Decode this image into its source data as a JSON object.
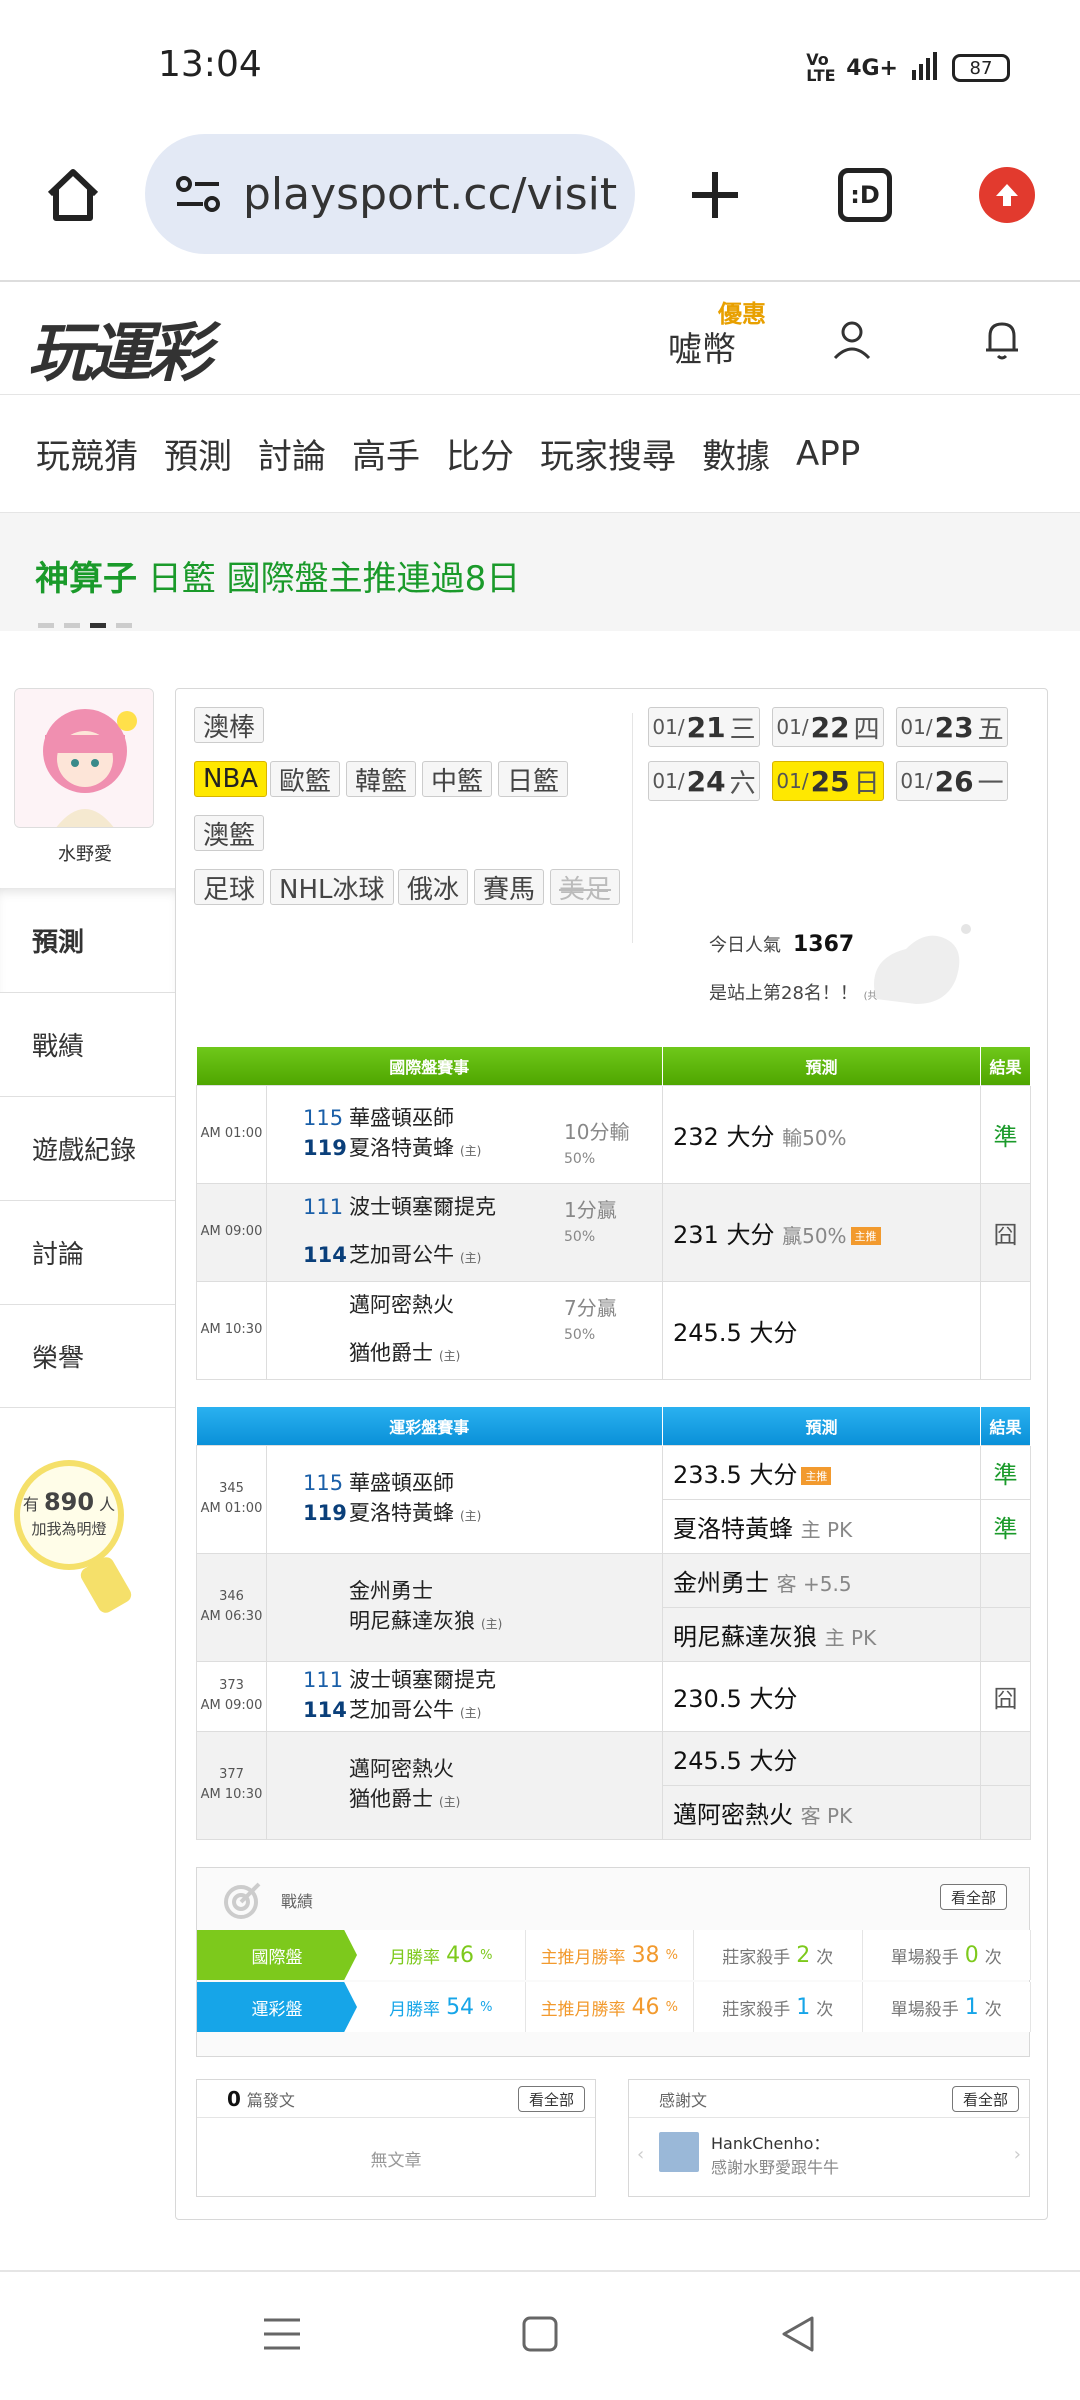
{
  "status": {
    "time": "13:04",
    "network": "4G+",
    "volte": "Vo LTE",
    "battery": "87"
  },
  "browser": {
    "url": "playsport.cc/visit",
    "tab_label": ":D"
  },
  "site": {
    "logo": "玩運彩",
    "coins_label": "噓幣",
    "promo_label": "優惠"
  },
  "nav": {
    "items": [
      "玩競猜",
      "預測",
      "討論",
      "高手",
      "比分",
      "玩家搜尋",
      "數據",
      "APP"
    ]
  },
  "banner": {
    "bold": "神算子",
    "text": " 日籃 國際盤主推連過8日"
  },
  "profile": {
    "name": "水野愛",
    "menu": [
      "預測",
      "戰績",
      "遊戲紀錄",
      "討論",
      "榮譽"
    ],
    "fans_prefix": "有",
    "fans_count": "890",
    "fans_suffix": "人",
    "fans_cta": "加我為明燈"
  },
  "sports": {
    "row1": [
      "澳棒"
    ],
    "row2": [
      "NBA",
      "歐籃",
      "韓籃",
      "中籃",
      "日籃"
    ],
    "row3": [
      "澳籃"
    ],
    "row4": [
      "足球",
      "NHL冰球",
      "俄冰",
      "賽馬",
      "美足"
    ]
  },
  "dates": [
    {
      "m": "01/",
      "d": "21",
      "w": "三"
    },
    {
      "m": "01/",
      "d": "22",
      "w": "四"
    },
    {
      "m": "01/",
      "d": "23",
      "w": "五"
    },
    {
      "m": "01/",
      "d": "24",
      "w": "六"
    },
    {
      "m": "01/",
      "d": "25",
      "w": "日"
    },
    {
      "m": "01/",
      "d": "26",
      "w": "一"
    }
  ],
  "popularity": {
    "label": "今日人氣",
    "value": "1367",
    "rank": "是站上第28名！！",
    "rank_note": "(共20189人)"
  },
  "intl": {
    "headers": [
      "國際盤賽事",
      "預測",
      "結果"
    ],
    "rows": [
      {
        "time": "AM 01:00",
        "n1": "115",
        "t1": "華盛頓巫師",
        "n2": "119",
        "t2": "夏洛特黃蜂",
        "home": "(主)",
        "sp1": "10分輸",
        "sp2": "50%",
        "pred": "232 大分",
        "meta": "輸50%",
        "tag": "",
        "res": "準"
      },
      {
        "time": "AM 09:00",
        "n1": "111",
        "t1": "波士頓塞爾提克",
        "n2": "114",
        "t2": "芝加哥公牛",
        "home": "(主)",
        "sp1": "1分贏",
        "sp2": "50%",
        "pred": "231 大分",
        "meta": "贏50%",
        "tag": "主推",
        "res": "囧"
      },
      {
        "time": "AM 10:30",
        "n1": "",
        "t1": "邁阿密熱火",
        "n2": "",
        "t2": "猶他爵士",
        "home": "(主)",
        "sp1": "7分贏",
        "sp2": "50%",
        "pred": "245.5 大分",
        "meta": "",
        "tag": "",
        "res": ""
      }
    ]
  },
  "lottery": {
    "headers": [
      "運彩盤賽事",
      "預測",
      "結果"
    ],
    "rows": [
      {
        "no": "345",
        "time": "AM 01:00",
        "n1": "115",
        "t1": "華盛頓巫師",
        "n2": "119",
        "t2": "夏洛特黃蜂",
        "home": "(主)",
        "p1": "233.5 大分",
        "m1": "",
        "tag1": "主推",
        "r1": "準",
        "p2": "夏洛特黃蜂",
        "m2": "主 PK",
        "r2": "準"
      },
      {
        "no": "346",
        "time": "AM 06:30",
        "n1": "",
        "t1": "金州勇士",
        "n2": "",
        "t2": "明尼蘇達灰狼",
        "home": "(主)",
        "p1": "金州勇士",
        "m1": "客 +5.5",
        "tag1": "",
        "r1": "",
        "p2": "明尼蘇達灰狼",
        "m2": "主 PK",
        "r2": ""
      },
      {
        "no": "373",
        "time": "AM 09:00",
        "n1": "111",
        "t1": "波士頓塞爾提克",
        "n2": "114",
        "t2": "芝加哥公牛",
        "home": "(主)",
        "p1": "230.5 大分",
        "m1": "",
        "tag1": "",
        "r1": "囧"
      },
      {
        "no": "377",
        "time": "AM 10:30",
        "n1": "",
        "t1": "邁阿密熱火",
        "n2": "",
        "t2": "猶他爵士",
        "home": "(主)",
        "p1": "245.5 大分",
        "m1": "",
        "tag1": "",
        "r1": "",
        "p2": "邁阿密熱火",
        "m2": "客 PK",
        "r2": ""
      }
    ]
  },
  "record": {
    "title": "戰績",
    "see_all": "看全部",
    "rows": [
      {
        "label": "國際盤",
        "monthly": "46",
        "main": "38",
        "banker": "2",
        "single": "0"
      },
      {
        "label": "運彩盤",
        "monthly": "54",
        "main": "46",
        "banker": "1",
        "single": "1"
      }
    ],
    "labels": {
      "monthly": "月勝率",
      "main": "主推月勝率",
      "banker": "莊家殺手",
      "single": "單場殺手",
      "pct": "%",
      "times": "次"
    },
    "colors": {
      "green": "#7dc91c",
      "blue": "#16a5e8",
      "orange": "#f29a2e"
    }
  },
  "posts": {
    "count": "0",
    "label": "篇發文",
    "see_all": "看全部",
    "empty": "無文章"
  },
  "thanks": {
    "label": "感謝文",
    "see_all": "看全部",
    "user": "HankChenho：",
    "text": "感謝水野愛跟牛牛"
  }
}
